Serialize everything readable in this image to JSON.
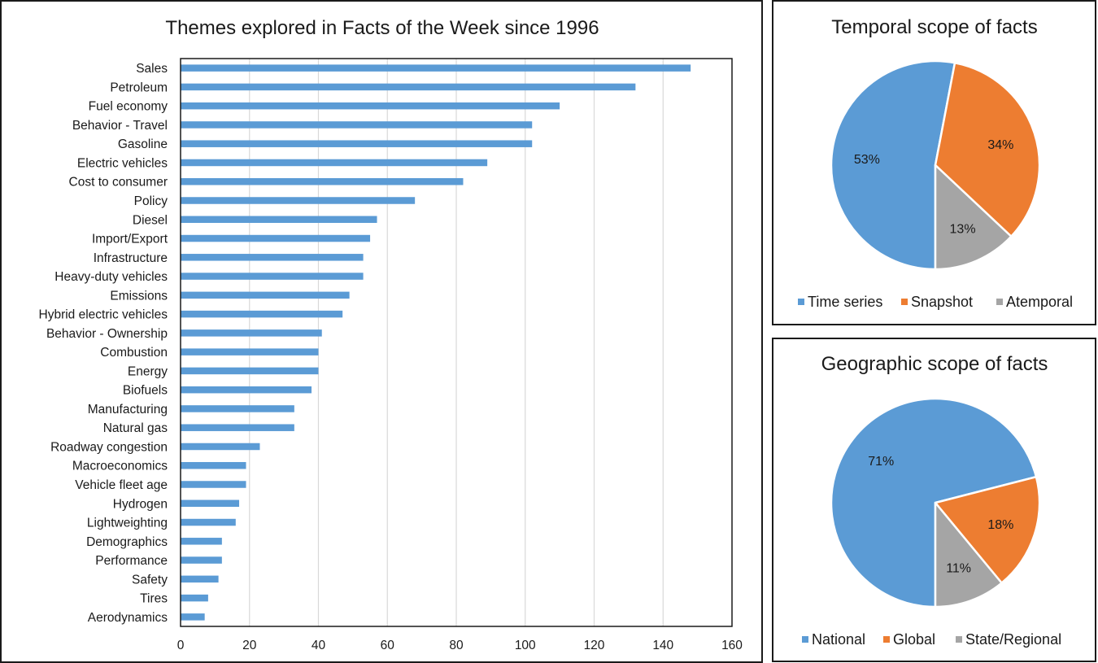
{
  "chart_data": [
    {
      "type": "bar",
      "orientation": "horizontal",
      "title": "Themes explored in Facts of the Week since 1996",
      "xlabel": "",
      "ylabel": "",
      "xlim": [
        0,
        160
      ],
      "xticks": [
        0,
        20,
        40,
        60,
        80,
        100,
        120,
        140,
        160
      ],
      "grid": true,
      "color": "#5b9bd5",
      "categories": [
        "Sales",
        "Petroleum",
        "Fuel economy",
        "Behavior - Travel",
        "Gasoline",
        "Electric vehicles",
        "Cost to consumer",
        "Policy",
        "Diesel",
        "Import/Export",
        "Infrastructure",
        "Heavy-duty vehicles",
        "Emissions",
        "Hybrid electric vehicles",
        "Behavior - Ownership",
        "Combustion",
        "Energy",
        "Biofuels",
        "Manufacturing",
        "Natural gas",
        "Roadway congestion",
        "Macroeconomics",
        "Vehicle fleet age",
        "Hydrogen",
        "Lightweighting",
        "Demographics",
        "Performance",
        "Safety",
        "Tires",
        "Aerodynamics"
      ],
      "values": [
        148,
        132,
        110,
        102,
        102,
        89,
        82,
        68,
        57,
        55,
        53,
        53,
        49,
        47,
        41,
        40,
        40,
        38,
        33,
        33,
        23,
        19,
        19,
        17,
        16,
        12,
        12,
        11,
        8,
        7
      ]
    },
    {
      "type": "pie",
      "title": "Temporal scope of facts",
      "legend_position": "bottom",
      "start_angle_deg": 180,
      "slices": [
        {
          "name": "Time series",
          "value": 53,
          "label": "53%",
          "color": "#5b9bd5"
        },
        {
          "name": "Snapshot",
          "value": 34,
          "label": "34%",
          "color": "#ed7d31"
        },
        {
          "name": "Atemporal",
          "value": 13,
          "label": "13%",
          "color": "#a5a5a5"
        }
      ]
    },
    {
      "type": "pie",
      "title": "Geographic scope of facts",
      "legend_position": "bottom",
      "start_angle_deg": 180,
      "slices": [
        {
          "name": "National",
          "value": 71,
          "label": "71%",
          "color": "#5b9bd5"
        },
        {
          "name": "Global",
          "value": 18,
          "label": "18%",
          "color": "#ed7d31"
        },
        {
          "name": "State/Regional",
          "value": 11,
          "label": "11%",
          "color": "#a5a5a5"
        }
      ]
    }
  ]
}
